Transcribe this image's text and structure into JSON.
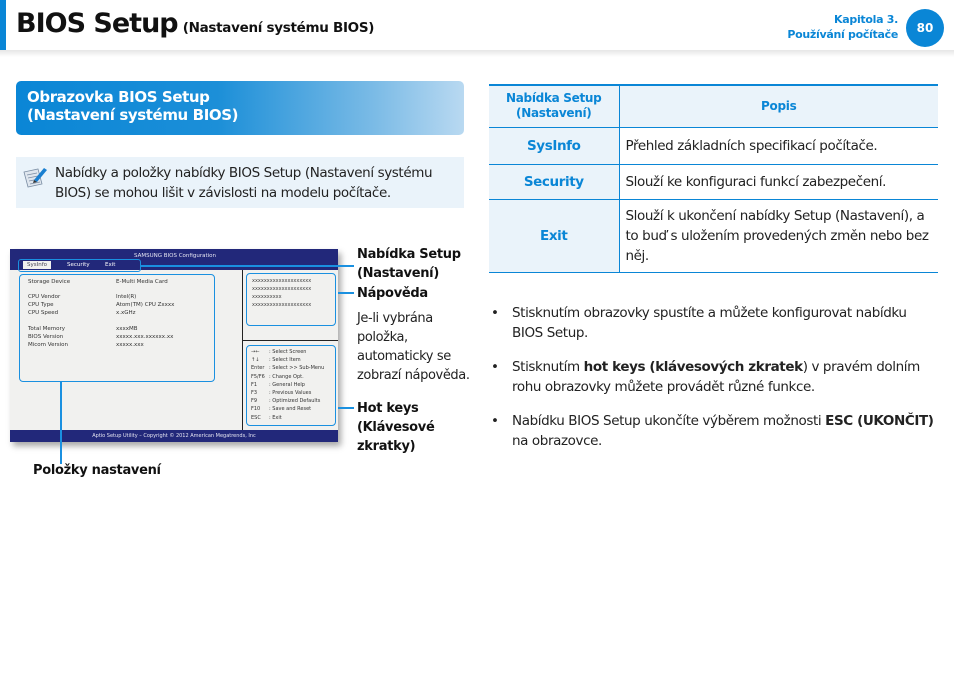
{
  "header": {
    "title": "BIOS Setup",
    "subtitle": "(Nastavení systému BIOS)",
    "chapter_line1": "Kapitola 3.",
    "chapter_line2": "Používání počítače",
    "page_number": "80",
    "accent_color": "#0a86d6"
  },
  "section": {
    "heading_line1": "Obrazovka BIOS Setup",
    "heading_line2": "(Nastavení systému BIOS)"
  },
  "note": {
    "icon": "note-pencil-icon",
    "text": "Nabídky a položky nabídky BIOS Setup (Nastavení systému BIOS) se mohou lišit v závislosti na modelu počítače."
  },
  "bios_screen": {
    "brand": "SAMSUNG BIOS Configuration",
    "tabs": [
      "SysInfo",
      "Security",
      "Exit"
    ],
    "active_tab": "SysInfo",
    "rows": [
      {
        "label": "Storage Device",
        "value": "E-Multi Media Card"
      },
      {
        "label": "CPU Vendor",
        "value": "Intel(R)"
      },
      {
        "label": "CPU Type",
        "value": "Atom(TM) CPU Zxxxx"
      },
      {
        "label": "CPU Speed",
        "value": "x.xGHz"
      },
      {
        "label": "Total Memory",
        "value": "xxxxMB"
      },
      {
        "label": "BIOS Version",
        "value": "xxxxx.xxx.xxxxxx.xx"
      },
      {
        "label": "Micom Version",
        "value": "xxxxx.xxx"
      }
    ],
    "help_lines": [
      "xxxxxxxxxxxxxxxxxxxx",
      "xxxxxxxxxxxxxxxxxxxx",
      "xxxxxxxxxx",
      "xxxxxxxxxxxxxxxxxxxx"
    ],
    "hotkeys": [
      {
        "key": "→←",
        "action": ": Select Screen"
      },
      {
        "key": "↑↓",
        "action": ": Select Item"
      },
      {
        "key": "Enter",
        "action": ": Select >> Sub-Menu"
      },
      {
        "key": "F5/F6",
        "action": ": Change Opt."
      },
      {
        "key": "F1",
        "action": ": General Help"
      },
      {
        "key": "F3",
        "action": ": Previous Values"
      },
      {
        "key": "F9",
        "action": ": Optimized Defaults"
      },
      {
        "key": "F10",
        "action": ": Save and Reset"
      },
      {
        "key": "ESC",
        "action": ": Exit"
      }
    ],
    "footer": "Aptio Setup Utility – Copyright © 2012 American Megatrends, Inc"
  },
  "callouts": {
    "menu_line1": "Nabídka Setup",
    "menu_line2": "(Nastavení)",
    "help_title": "Nápověda",
    "help_desc_lines": [
      "Je-li vybrána",
      "položka,",
      "automaticky se",
      "zobrazí nápověda."
    ],
    "hotkeys_lines": [
      "Hot keys",
      "(Klávesové",
      "zkratky)"
    ],
    "items": "Položky nastavení"
  },
  "table": {
    "headers": [
      "Nabídka Setup (Nastavení)",
      "Popis"
    ],
    "header_col1_line1": "Nabídka Setup",
    "header_col1_line2": "(Nastavení)",
    "rows": [
      {
        "name": "SysInfo",
        "desc": "Přehled základních specifikací počítače."
      },
      {
        "name": "Security",
        "desc": "Slouží ke konfiguraci funkcí zabezpečení."
      },
      {
        "name": "Exit",
        "desc": "Slouží k ukončení nabídky Setup (Nastavení), a to buď s uložením provedených změn nebo bez něj."
      }
    ]
  },
  "bullets": [
    {
      "parts": [
        {
          "t": "Stisknutím obrazovky spustíte a můžete konfigurovat nabídku BIOS Setup.",
          "b": false
        }
      ]
    },
    {
      "parts": [
        {
          "t": "Stisknutím ",
          "b": false
        },
        {
          "t": "hot keys (klávesových zkratek",
          "b": true
        },
        {
          "t": ") v pravém dolním rohu obrazovky můžete provádět různé funkce.",
          "b": false
        }
      ]
    },
    {
      "parts": [
        {
          "t": "Nabídku BIOS Setup ukončíte výběrem možnosti ",
          "b": false
        },
        {
          "t": "ESC (UKONČIT)",
          "b": true
        },
        {
          "t": " na obrazovce.",
          "b": false
        }
      ]
    }
  ]
}
